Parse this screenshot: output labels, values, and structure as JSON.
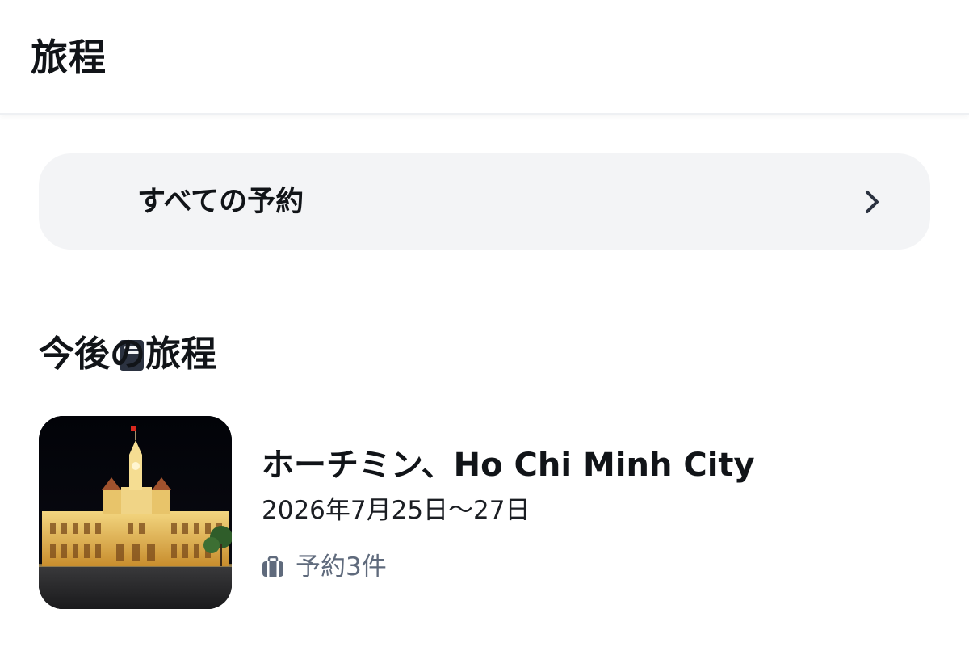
{
  "header": {
    "title": "旅程"
  },
  "all_bookings": {
    "label": "すべての予約",
    "icon": "book-icon",
    "chevron": "chevron-right-icon"
  },
  "upcoming": {
    "heading": "今後の旅程",
    "trips": [
      {
        "name": "ホーチミン、Ho Chi Minh City",
        "dates": "2026年7月25日〜27日",
        "bookings_label": "予約3件",
        "bookings_icon": "luggage-icon",
        "thumbnail": "city-hall-night-photo"
      }
    ]
  },
  "colors": {
    "text": "#111418",
    "muted": "#5f6a7c",
    "row_background": "#f3f4f6",
    "icon_dark": "#2b3240"
  }
}
